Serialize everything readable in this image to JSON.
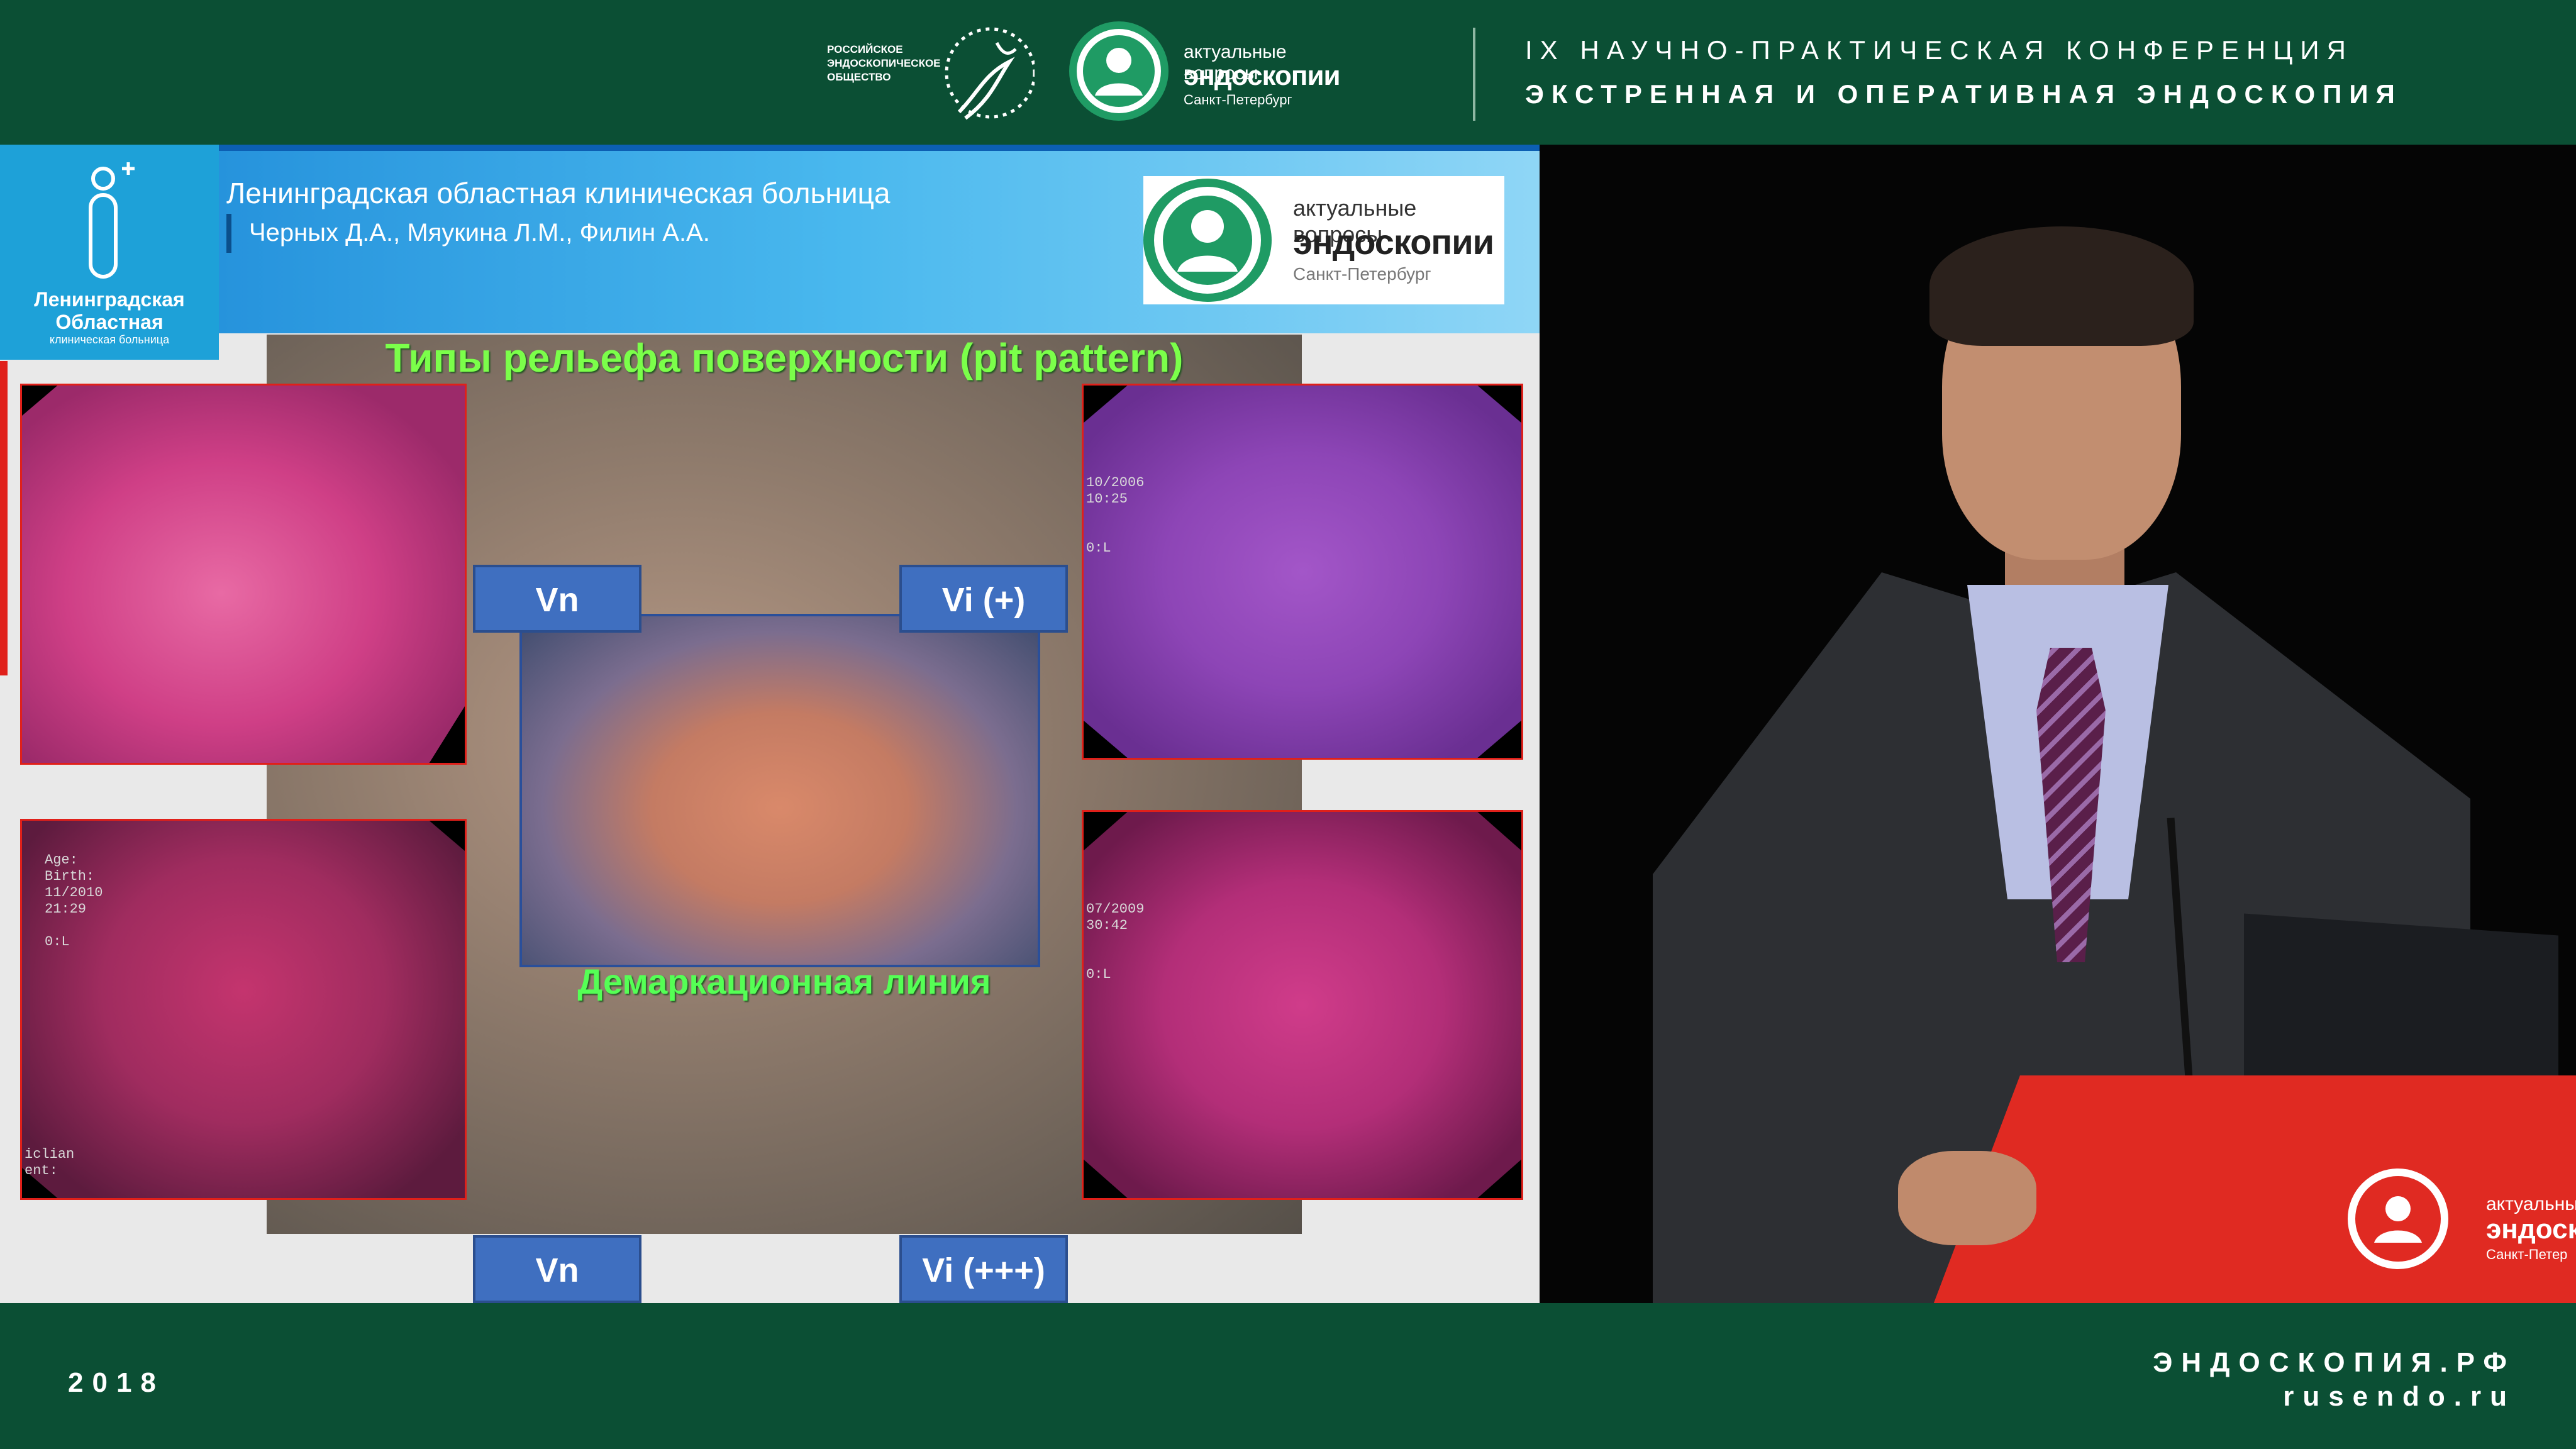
{
  "top_banner": {
    "society_text": [
      "РОССИЙСКОЕ",
      "ЭНДОСКОПИЧЕСКОЕ",
      "ОБЩЕСТВО"
    ],
    "logo_line1": "актуальные вопросы",
    "logo_line2": "эндоскопии",
    "logo_line3": "Санкт-Петербург",
    "conference_line1": "IX НАУЧНО-ПРАКТИЧЕСКАЯ КОНФЕРЕНЦИЯ",
    "conference_line2": "ЭКСТРЕННАЯ И ОПЕРАТИВНАЯ ЭНДОСКОПИЯ"
  },
  "bottom_banner": {
    "year": "2018",
    "site_ru": "ЭНДОСКОПИЯ.РФ",
    "site_en": "rusendo.ru"
  },
  "slide": {
    "hospital_logo_lines": [
      "Ленинградская",
      "Областная",
      "клиническая больница"
    ],
    "hospital_title": "Ленинградская областная клиническая больница",
    "authors": "Черных Д.А., Мяукина Л.М., Филин А.А.",
    "logo_line1": "актуальные вопросы",
    "logo_line2": "эндоскопии",
    "logo_line3": "Санкт-Петербург",
    "title": "Типы рельефа поверхности (pit pattern)",
    "demarcation": "Демаркационная линия",
    "labels": {
      "vn_top": "Vn",
      "vi_plus": "Vi (+)",
      "vn_bottom": "Vn",
      "vi_ppp": "Vi (+++)"
    },
    "image_overlays": {
      "bottom_left": [
        "Age:",
        "Birth:",
        "11/2010",
        "21:29",
        "",
        "0:L",
        "",
        "",
        "",
        "iclian",
        "ent:"
      ],
      "top_right": [
        "10/2006",
        "10:25",
        "",
        "",
        "0:L"
      ],
      "bottom_right": [
        "07/2009",
        "30:42",
        "",
        "",
        "0:L"
      ]
    }
  },
  "podium": {
    "logo_line1": "актуальные",
    "logo_line2": "эндоск",
    "logo_line3": "Санкт-Петер"
  },
  "colors": {
    "banner_green": "#0b4f34",
    "title_green": "#7bff4a",
    "label_blue": "#3f6fc0",
    "podium_red": "#e02a22"
  }
}
